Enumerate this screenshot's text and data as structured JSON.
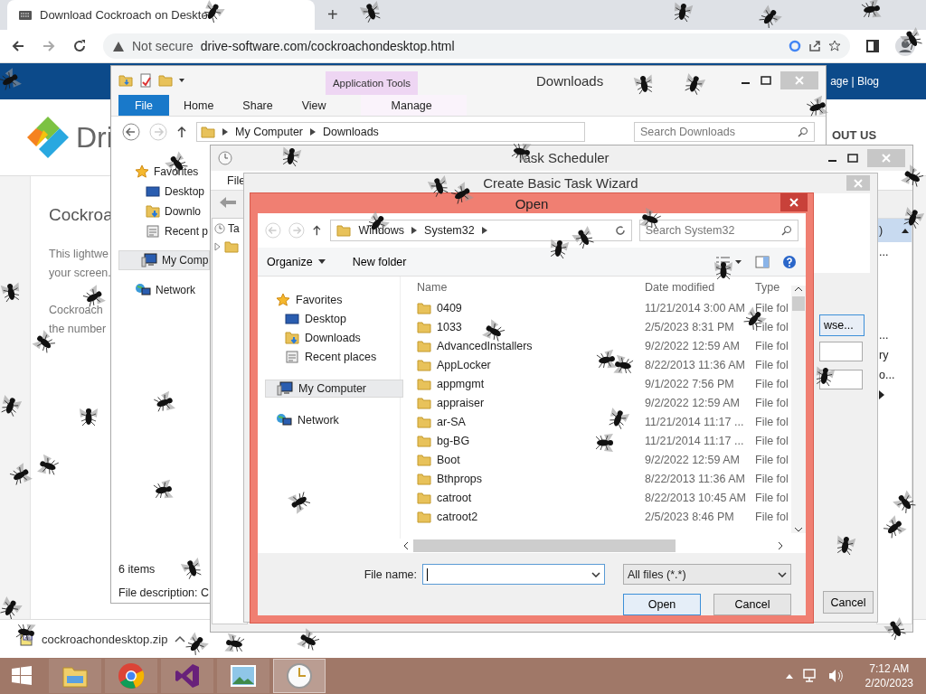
{
  "browser": {
    "tab_title": "Download Cockroach on Deskto",
    "new_tab": "+",
    "security": "Not secure",
    "url": "drive-software.com/cockroachondesktop.html",
    "header_links": "age | Blog",
    "logo_text": "Dri",
    "nav_item": "OUT US",
    "heading": "Cockroa",
    "paragraphs": [
      "This lightwe",
      "your screen.",
      "Cockroach",
      "the number"
    ],
    "download_file": "cockroachondesktop.zip"
  },
  "explorer": {
    "title": "Downloads",
    "context_tab": "Application Tools",
    "ribbon_tabs": [
      {
        "label": "File",
        "kind": "file"
      },
      {
        "label": "Home",
        "kind": "tab"
      },
      {
        "label": "Share",
        "kind": "tab"
      },
      {
        "label": "View",
        "kind": "tab"
      },
      {
        "label": "Manage",
        "kind": "context"
      }
    ],
    "path": [
      "My Computer",
      "Downloads"
    ],
    "search_placeholder": "Search Downloads",
    "nav": [
      {
        "label": "Favorites",
        "kind": "favorites",
        "selected": false
      },
      {
        "label": "Desktop",
        "kind": "desktop",
        "selected": false
      },
      {
        "label": "Downlo",
        "kind": "downloads",
        "selected": false
      },
      {
        "label": "Recent p",
        "kind": "recent",
        "selected": false
      },
      {
        "label": "My Comp",
        "kind": "computer",
        "selected": true
      },
      {
        "label": "Network",
        "kind": "network",
        "selected": false
      }
    ],
    "status": "6 items",
    "details": "File description: C"
  },
  "task_scheduler": {
    "title": "Task Scheduler",
    "menu": [
      "File"
    ],
    "tree": [
      "Ta"
    ],
    "actions_header": ")",
    "actions": [
      "...",
      "...",
      "ry",
      "o..."
    ]
  },
  "wizard": {
    "title": "Create Basic Task Wizard",
    "browse": "wse...",
    "cancel": "Cancel"
  },
  "open_dialog": {
    "title": "Open",
    "path": [
      "Windows",
      "System32"
    ],
    "search_placeholder": "Search System32",
    "toolbar": [
      "Organize",
      "New folder"
    ],
    "nav": [
      {
        "label": "Favorites",
        "kind": "favorites",
        "selected": false
      },
      {
        "label": "Desktop",
        "kind": "desktop",
        "selected": false
      },
      {
        "label": "Downloads",
        "kind": "downloads",
        "selected": false
      },
      {
        "label": "Recent places",
        "kind": "recent",
        "selected": false
      },
      {
        "label": "My Computer",
        "kind": "computer",
        "selected": true
      },
      {
        "label": "Network",
        "kind": "network",
        "selected": false
      }
    ],
    "columns": [
      "Name",
      "Date modified",
      "Type"
    ],
    "rows": [
      {
        "name": "0409",
        "date": "11/21/2014 3:00 AM",
        "type": "File fol"
      },
      {
        "name": "1033",
        "date": "2/5/2023 8:31 PM",
        "type": "File fol"
      },
      {
        "name": "AdvancedInstallers",
        "date": "9/2/2022 12:59 AM",
        "type": "File fol"
      },
      {
        "name": "AppLocker",
        "date": "8/22/2013 11:36 AM",
        "type": "File fol"
      },
      {
        "name": "appmgmt",
        "date": "9/1/2022 7:56 PM",
        "type": "File fol"
      },
      {
        "name": "appraiser",
        "date": "9/2/2022 12:59 AM",
        "type": "File fol"
      },
      {
        "name": "ar-SA",
        "date": "11/21/2014 11:17 ...",
        "type": "File fol"
      },
      {
        "name": "bg-BG",
        "date": "11/21/2014 11:17 ...",
        "type": "File fol"
      },
      {
        "name": "Boot",
        "date": "9/2/2022 12:59 AM",
        "type": "File fol"
      },
      {
        "name": "Bthprops",
        "date": "8/22/2013 11:36 AM",
        "type": "File fol"
      },
      {
        "name": "catroot",
        "date": "8/22/2013 10:45 AM",
        "type": "File fol"
      },
      {
        "name": "catroot2",
        "date": "2/5/2023 8:46 PM",
        "type": "File fol"
      }
    ],
    "file_name_label": "File name:",
    "file_type": "All files (*.*)",
    "buttons": [
      "Open",
      "Cancel"
    ]
  },
  "taskbar": {
    "apps": [
      {
        "kind": "explorer",
        "active": false
      },
      {
        "kind": "chrome",
        "active": false
      },
      {
        "kind": "visual-studio",
        "active": false
      },
      {
        "kind": "photos",
        "active": false
      },
      {
        "kind": "clock",
        "active": true
      }
    ],
    "time": "7:12 AM",
    "date": "2/20/2023"
  }
}
